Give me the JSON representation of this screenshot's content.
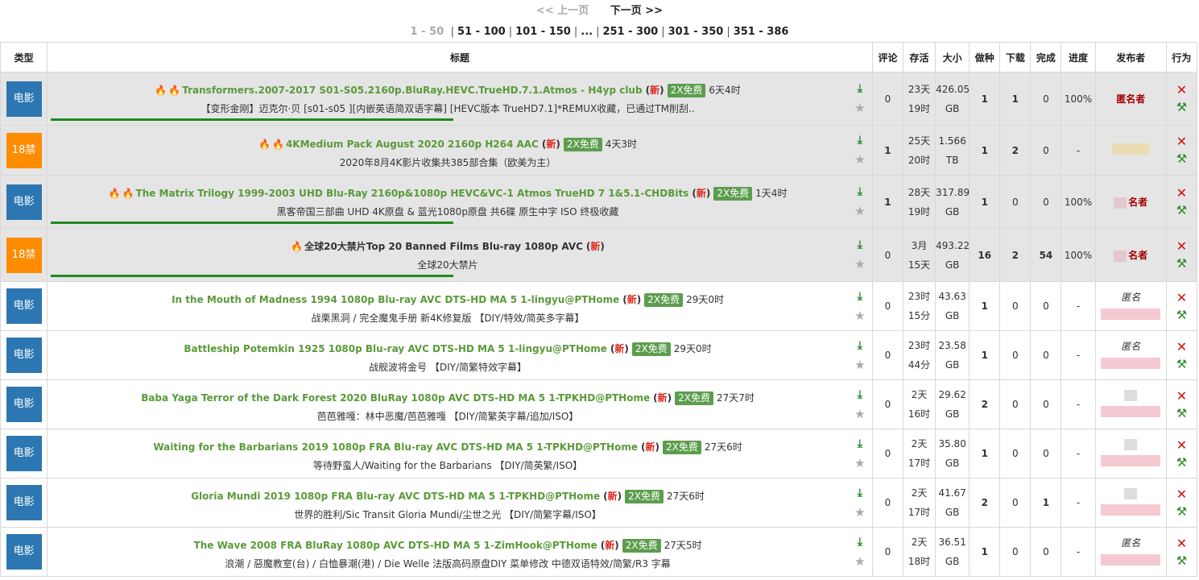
{
  "pager": {
    "prev": "<< 上一页",
    "next": "下一页 >>",
    "current": "1 - 50",
    "pages": [
      "51 - 100",
      "101 - 150",
      "...",
      "251 - 300",
      "301 - 350",
      "351 - 386"
    ]
  },
  "headers": [
    "类型",
    "标题",
    "评论",
    "存活",
    "大小",
    "做种",
    "下载",
    "完成",
    "进度",
    "发布者",
    "行为"
  ],
  "rows": [
    {
      "type": "电影",
      "type_style": "movie",
      "hl": true,
      "fires": 2,
      "title": "Transformers.2007-2017 S01-S05.2160p.BluRay.HEVC.TrueHD.7.1.Atmos - H4yp club",
      "new": "新",
      "free": "2X免费",
      "time": "6天4时",
      "sub": "【变形金刚】迈克尔·贝 [s01-s05 ][内嵌英语简双语字幕] [HEVC版本 TrueHD7.1]*REMUX收藏，已通过TM削刮..",
      "bar": true,
      "comments": "0",
      "alive1": "23天",
      "alive2": "19时",
      "size1": "426.05",
      "size2": "GB",
      "seed": "1",
      "leech": "1",
      "done": "0",
      "prog": "100%",
      "uploader": "匿名者",
      "up_style": "anon"
    },
    {
      "type": "18禁",
      "type_style": "adult",
      "hl": true,
      "fires": 2,
      "title": "4KMedium Pack August 2020 2160p H264 AAC",
      "new": "新",
      "free": "2X免费",
      "time": "4天3时",
      "sub": "2020年8月4K影片收集共385部合集（欧美为主）",
      "bar": false,
      "comments": "1",
      "alive1": "25天",
      "alive2": "20时",
      "size1": "1.566",
      "size2": "TB",
      "seed": "1",
      "leech": "2",
      "done": "0",
      "prog": "-",
      "uploader": "",
      "up_style": "tan"
    },
    {
      "type": "电影",
      "type_style": "movie",
      "hl": true,
      "fires": 2,
      "title": "The Matrix Trilogy 1999-2003 UHD Blu-Ray 2160p&1080p HEVC&VC-1 Atmos TrueHD 7 1&5.1-CHDBits",
      "new": "新",
      "free": "2X免费",
      "time": "1天4时",
      "sub": "黑客帝国三部曲 UHD 4K原盘 & 蓝光1080p原盘 共6碟 原生中字 ISO 终极收藏",
      "bar": true,
      "comments": "1",
      "alive1": "28天",
      "alive2": "19时",
      "size1": "317.89",
      "size2": "GB",
      "seed": "1",
      "leech": "0",
      "done": "0",
      "prog": "100%",
      "uploader": "名者",
      "up_style": "anonmix"
    },
    {
      "type": "18禁",
      "type_style": "adult",
      "hl": true,
      "fires": 1,
      "title": "全球20大禁片Top 20 Banned Films Blu-ray 1080p AVC",
      "new": "新",
      "free": "",
      "time": "",
      "sub": "全球20大禁片",
      "bar": true,
      "dark": true,
      "comments": "0",
      "alive1": "3月",
      "alive2": "15天",
      "size1": "493.22",
      "size2": "GB",
      "seed": "16",
      "leech": "2",
      "done": "54",
      "prog": "100%",
      "uploader": "名者",
      "up_style": "anonmix"
    },
    {
      "type": "电影",
      "type_style": "movie",
      "hl": false,
      "fires": 0,
      "title": "In the Mouth of Madness 1994 1080p Blu-ray AVC DTS-HD MA 5 1-lingyu@PTHome",
      "new": "新",
      "free": "2X免费",
      "time": "29天0时",
      "sub": "战栗黑洞 / 完全魔鬼手册 新4K修复版 【DIY/特效/简英多字幕】",
      "bar": false,
      "comments": "0",
      "alive1": "23时",
      "alive2": "15分",
      "size1": "43.63",
      "size2": "GB",
      "seed": "1",
      "leech": "0",
      "done": "0",
      "prog": "-",
      "uploader": "匿名",
      "up_style": "italic"
    },
    {
      "type": "电影",
      "type_style": "movie",
      "hl": false,
      "fires": 0,
      "title": "Battleship Potemkin 1925 1080p Blu-ray AVC DTS-HD MA 5 1-lingyu@PTHome",
      "new": "新",
      "free": "2X免费",
      "time": "29天0时",
      "sub": "战舰波将金号 【DIY/简繁特效字幕】",
      "bar": false,
      "comments": "0",
      "alive1": "23时",
      "alive2": "44分",
      "size1": "23.58",
      "size2": "GB",
      "seed": "1",
      "leech": "0",
      "done": "0",
      "prog": "-",
      "uploader": "匿名",
      "up_style": "italic"
    },
    {
      "type": "电影",
      "type_style": "movie",
      "hl": false,
      "fires": 0,
      "title": "Baba Yaga Terror of the Dark Forest 2020 BluRay 1080p AVC DTS-HD MA 5 1-TPKHD@PTHome",
      "new": "新",
      "free": "2X免费",
      "time": "27天7时",
      "sub": "芭芭雅嘎：林中恶魔/芭芭雅嘎 【DIY/简繁英字幕/追加/ISO】",
      "bar": false,
      "comments": "0",
      "alive1": "2天",
      "alive2": "16时",
      "size1": "29.62",
      "size2": "GB",
      "seed": "2",
      "leech": "0",
      "done": "0",
      "prog": "-",
      "uploader": "",
      "up_style": "blur"
    },
    {
      "type": "电影",
      "type_style": "movie",
      "hl": false,
      "fires": 0,
      "title": "Waiting for the Barbarians 2019 1080p FRA Blu-ray AVC DTS-HD MA 5 1-TPKHD@PTHome",
      "new": "新",
      "free": "2X免费",
      "time": "27天6时",
      "sub": "等待野蛮人/Waiting for the Barbarians 【DIY/简英繁/ISO】",
      "bar": false,
      "comments": "0",
      "alive1": "2天",
      "alive2": "17时",
      "size1": "35.80",
      "size2": "GB",
      "seed": "1",
      "leech": "0",
      "done": "0",
      "prog": "-",
      "uploader": "",
      "up_style": "blur"
    },
    {
      "type": "电影",
      "type_style": "movie",
      "hl": false,
      "fires": 0,
      "title": "Gloria Mundi 2019 1080p FRA Blu-ray AVC DTS-HD MA 5 1-TPKHD@PTHome",
      "new": "新",
      "free": "2X免费",
      "time": "27天6时",
      "sub": "世界的胜利/Sic Transit Gloria Mundi/尘世之光 【DIY/简繁字幕/ISO】",
      "bar": false,
      "comments": "0",
      "alive1": "2天",
      "alive2": "17时",
      "size1": "41.67",
      "size2": "GB",
      "seed": "2",
      "leech": "0",
      "done": "1",
      "prog": "-",
      "uploader": "",
      "up_style": "blur"
    },
    {
      "type": "电影",
      "type_style": "movie",
      "hl": false,
      "fires": 0,
      "title": "The Wave 2008 FRA BluRay 1080p AVC DTS-HD MA 5 1-ZimHook@PTHome",
      "new": "新",
      "free": "2X免费",
      "time": "27天5时",
      "sub": "浪潮 / 惡魔教室(台) / 白恤暴潮(港) / Die Welle 法版高码原盘DIY 菜单修改 中德双语特效/简繁/R3 字幕",
      "bar": false,
      "comments": "0",
      "alive1": "2天",
      "alive2": "18时",
      "size1": "36.51",
      "size2": "GB",
      "seed": "1",
      "leech": "0",
      "done": "0",
      "prog": "-",
      "uploader": "匿名",
      "up_style": "italic"
    }
  ]
}
